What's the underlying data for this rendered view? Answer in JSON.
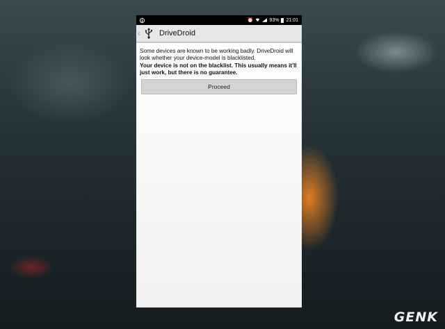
{
  "status_bar": {
    "battery": "93%",
    "time": "21:01",
    "icons": [
      "usb-icon",
      "alarm-icon",
      "wifi-icon",
      "signal-icon",
      "battery-icon"
    ]
  },
  "app_bar": {
    "title": "DriveDroid",
    "icon": "usb-icon"
  },
  "content": {
    "message": "Some devices are known to be working badly. DriveDroid will look whether your device-model is blacklisted.",
    "result": "Your device is not on the blacklist. This usually means it'll just work, but there is no guarantee.",
    "proceed_label": "Proceed"
  },
  "watermark": "GENK",
  "colors": {
    "status_bar": "#000000",
    "app_bar": "#e6e6e6",
    "button": "#d4d4d4",
    "glow": "#ff8c1e"
  }
}
